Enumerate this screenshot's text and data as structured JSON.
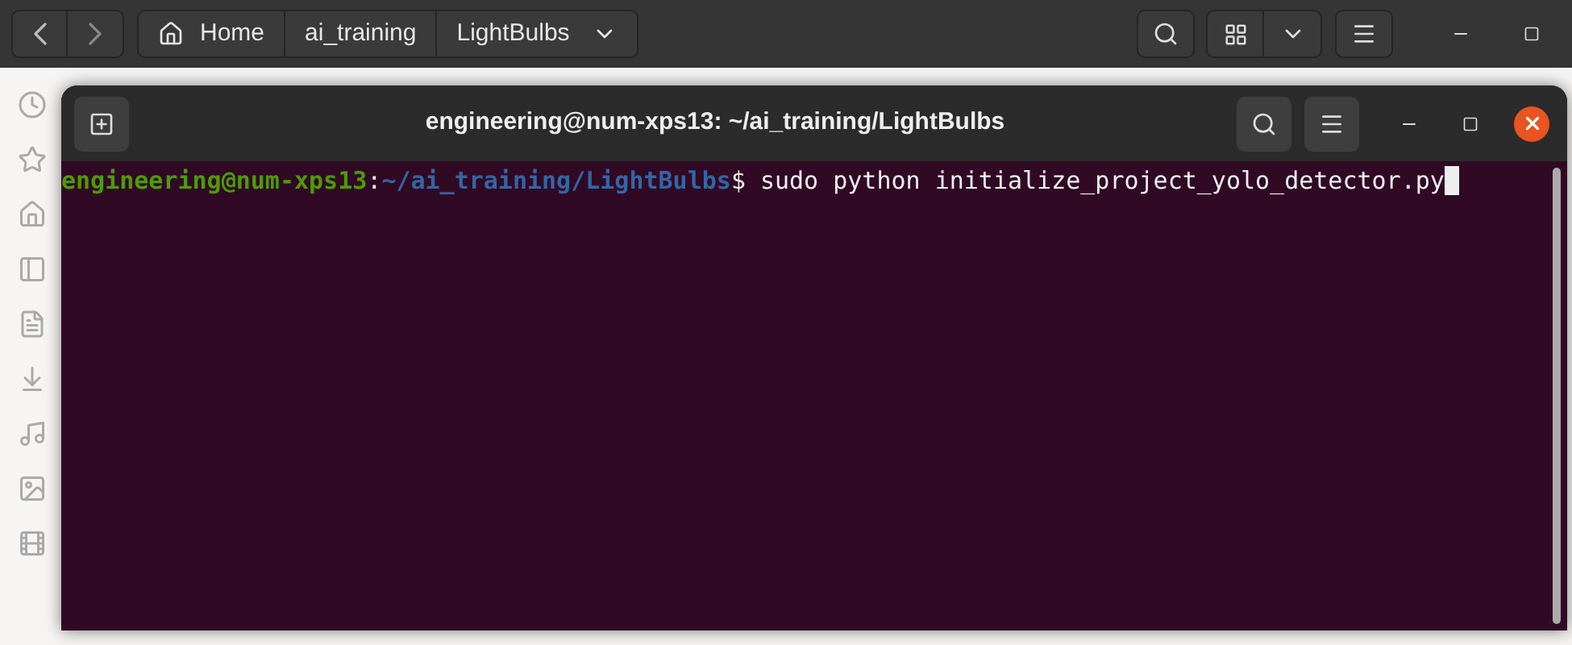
{
  "file_manager": {
    "breadcrumbs": [
      {
        "label": "Home",
        "kind": "home"
      },
      {
        "label": "ai_training",
        "kind": "folder"
      },
      {
        "label": "LightBulbs",
        "kind": "current"
      }
    ]
  },
  "terminal": {
    "title": "engineering@num-xps13: ~/ai_training/LightBulbs",
    "lines": [
      {
        "user_host": "engineering@num-xps13",
        "separator": ":",
        "path": "~/ai_training/LightBulbs",
        "prompt": "$",
        "command": "sudo python initialize_project_yolo_detector.py",
        "cursor": true
      }
    ]
  }
}
